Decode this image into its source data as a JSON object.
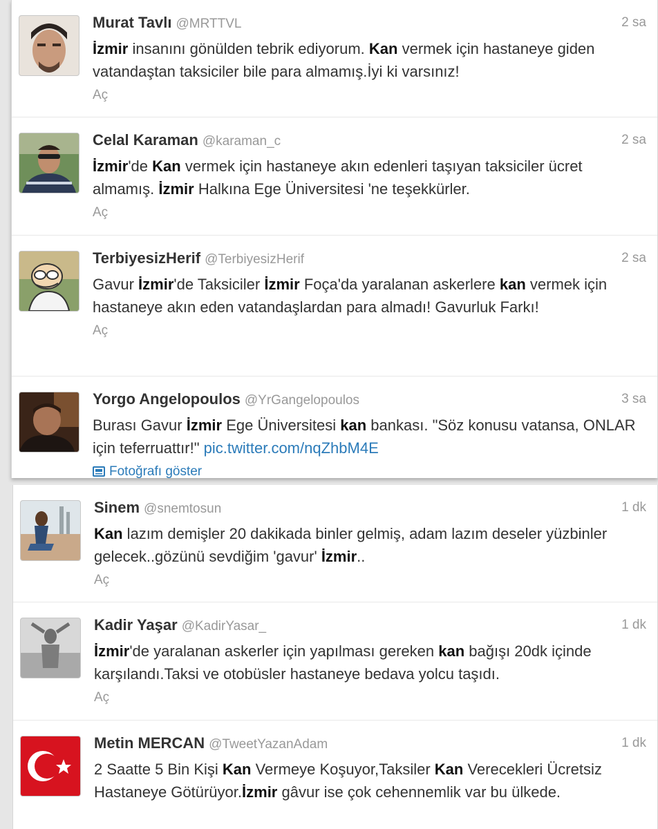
{
  "tweets_top": [
    {
      "name": "Murat Tavlı",
      "handle": "@MRTTVL",
      "time": "2 sa",
      "action": "Aç",
      "segments": [
        {
          "t": "İzmir",
          "b": true
        },
        {
          "t": " insanını gönülden tebrik ediyorum. "
        },
        {
          "t": "Kan",
          "b": true
        },
        {
          "t": " vermek için hastaneye giden vatandaştan taksiciler bile para almamış.İyi ki varsınız!"
        }
      ]
    },
    {
      "name": "Celal Karaman",
      "handle": "@karaman_c",
      "time": "2 sa",
      "action": "Aç",
      "segments": [
        {
          "t": "İzmir",
          "b": true
        },
        {
          "t": "'de "
        },
        {
          "t": "Kan",
          "b": true
        },
        {
          "t": " vermek için hastaneye akın edenleri taşıyan taksiciler ücret almamış. "
        },
        {
          "t": "İzmir",
          "b": true
        },
        {
          "t": " Halkına Ege Üniversitesi 'ne teşekkürler."
        }
      ]
    },
    {
      "name": "TerbiyesizHerif",
      "handle": "@TerbiyesizHerif",
      "time": "2 sa",
      "action": "Aç",
      "segments": [
        {
          "t": "Gavur "
        },
        {
          "t": "İzmir",
          "b": true
        },
        {
          "t": "'de Taksiciler "
        },
        {
          "t": "İzmir",
          "b": true
        },
        {
          "t": " Foça'da yaralanan askerlere "
        },
        {
          "t": "kan",
          "b": true
        },
        {
          "t": " vermek için hastaneye akın eden vatandaşlardan para almadı! Gavurluk Farkı!"
        }
      ]
    },
    {
      "name": "Yorgo Angelopoulos",
      "handle": "@YrGangelopoulos",
      "time": "3 sa",
      "action": "Fotoğrafı göster",
      "action_icon": "photo-icon",
      "segments": [
        {
          "t": "Burası Gavur "
        },
        {
          "t": "İzmir",
          "b": true
        },
        {
          "t": " Ege Üniversitesi "
        },
        {
          "t": "kan",
          "b": true
        },
        {
          "t": " bankası. \"Söz konusu vatansa, ONLAR için teferruattır!\" "
        },
        {
          "t": "pic.twitter.com/nqZhbM4E",
          "link": true
        }
      ]
    }
  ],
  "tweets_bottom": [
    {
      "name": "Sinem",
      "handle": "@snemtosun",
      "time": "1 dk",
      "action": "Aç",
      "segments": [
        {
          "t": "Kan",
          "b": true
        },
        {
          "t": " lazım demişler 20 dakikada binler gelmiş, adam lazım deseler yüzbinler gelecek..gözünü sevdiğim 'gavur' "
        },
        {
          "t": "İzmir",
          "b": true
        },
        {
          "t": ".."
        }
      ]
    },
    {
      "name": "Kadir Yaşar",
      "handle": "@KadirYasar_",
      "time": "1 dk",
      "action": "Aç",
      "segments": [
        {
          "t": "İzmir",
          "b": true
        },
        {
          "t": "'de yaralanan askerler için yapılması gereken "
        },
        {
          "t": "kan",
          "b": true
        },
        {
          "t": " bağışı 20dk içinde karşılandı.Taksi ve otobüsler hastaneye bedava yolcu taşıdı."
        }
      ]
    },
    {
      "name": "Metin MERCAN",
      "handle": "@TweetYazanAdam",
      "time": "1 dk",
      "action": "",
      "segments": [
        {
          "t": "2 Saatte 5 Bin Kişi "
        },
        {
          "t": "Kan",
          "b": true
        },
        {
          "t": " Vermeye Koşuyor,Taksiler "
        },
        {
          "t": "Kan",
          "b": true
        },
        {
          "t": " Verecekleri Ücretsiz Hastaneye Götürüyor."
        },
        {
          "t": "İzmir",
          "b": true
        },
        {
          "t": " gâvur ise çok cehennemlik var bu ülkede."
        }
      ]
    }
  ]
}
